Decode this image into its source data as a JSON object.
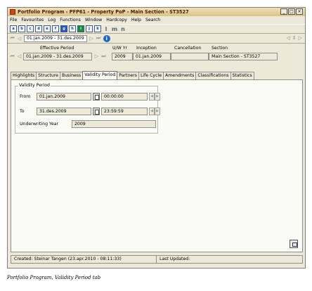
{
  "window": {
    "title": "Portfolio Program - PFP61 - Property PoP - Main Section - ST3527",
    "minimize": "_",
    "maximize": "□",
    "close": "×"
  },
  "menu": [
    "File",
    "Favourites",
    "Log",
    "Functions",
    "Window",
    "Hardcopy",
    "Help",
    "Search"
  ],
  "toolbar_icons": [
    {
      "glyph": "a"
    },
    {
      "glyph": "b"
    },
    {
      "glyph": "c"
    },
    {
      "glyph": "d"
    },
    {
      "glyph": "e"
    },
    {
      "glyph": "f"
    },
    {
      "glyph": "g"
    },
    {
      "glyph": "h"
    },
    {
      "glyph": "i"
    },
    {
      "glyph": "j"
    },
    {
      "glyph": "k"
    },
    {
      "glyph": "l"
    },
    {
      "glyph": "m"
    },
    {
      "glyph": "n"
    }
  ],
  "nav": {
    "period": "01.jan.2009 - 31.des.2009",
    "info": "i"
  },
  "header": {
    "effective_period_label": "Effective Period",
    "effective_period_value": "01.jan.2009 - 31.des.2009",
    "uw_yr_label": "U/W Yr",
    "uw_yr_value": "2009",
    "inception_label": "Inception",
    "inception_value": "01.jan.2009",
    "cancellation_label": "Cancellation",
    "cancellation_value": "",
    "section_label": "Section",
    "section_value": "Main Section - ST3527"
  },
  "tabs": [
    {
      "label": "Highlights"
    },
    {
      "label": "Structure"
    },
    {
      "label": "Business"
    },
    {
      "label": "Validity Period"
    },
    {
      "label": "Partners"
    },
    {
      "label": "Life Cycle"
    },
    {
      "label": "Amendments"
    },
    {
      "label": "Classifications"
    },
    {
      "label": "Statistics"
    }
  ],
  "validity": {
    "group_title": "Validity Period",
    "from_label": "From",
    "from_date": "01.jan.2009",
    "from_time": "00:00:00",
    "to_label": "To",
    "to_date": "31.des.2009",
    "to_time": "23:59:59",
    "underwriting_year_label": "Underwriting Year",
    "underwriting_year_value": "2009"
  },
  "status": {
    "created": "Created: Steinar Tangen (23.apr.2010 - 08:11:33)",
    "last_updated": "Last Updated:"
  },
  "caption": "Portfolio Program, Validity Period tab"
}
